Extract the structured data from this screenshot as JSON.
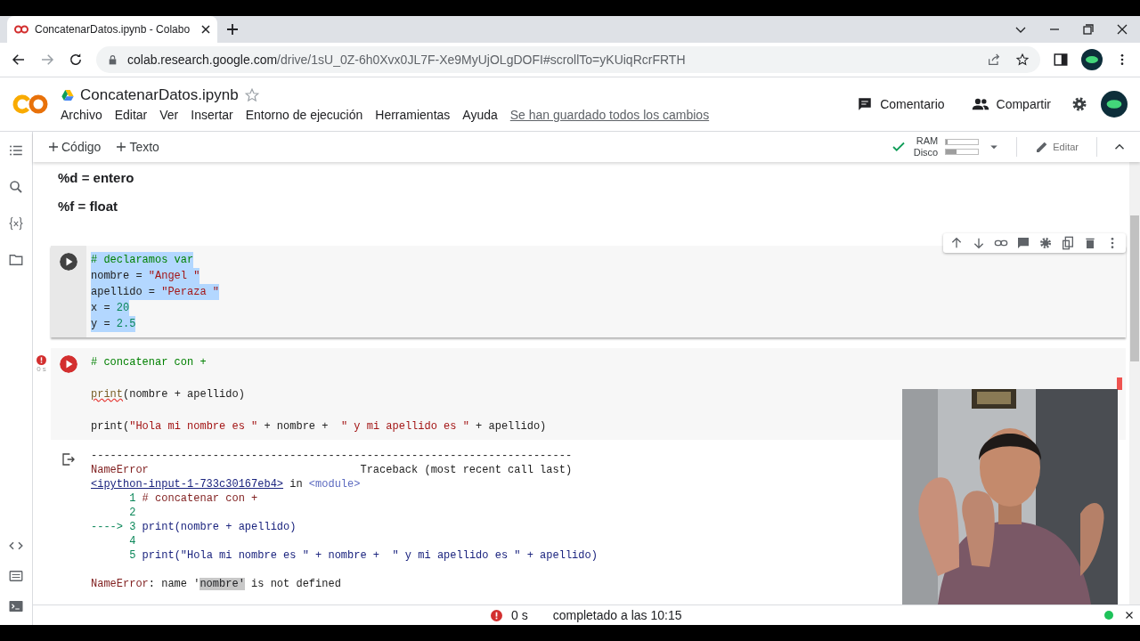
{
  "browser": {
    "tab_title": "ConcatenarDatos.ipynb - Colabo",
    "url_host": "colab.research.google.com",
    "url_path": "/drive/1sU_0Z-6h0Xvx0JL7F-Xe9MyUjOLgDOFI#scrollTo=yKUiqRcrFRTH"
  },
  "header": {
    "title": "ConcatenarDatos.ipynb",
    "menu": [
      "Archivo",
      "Editar",
      "Ver",
      "Insertar",
      "Entorno de ejecución",
      "Herramientas",
      "Ayuda"
    ],
    "save_status": "Se han guardado todos los cambios",
    "comment": "Comentario",
    "share": "Compartir"
  },
  "toolbar": {
    "add_code": "Código",
    "add_text": "Texto",
    "ram_label": "RAM",
    "disk_label": "Disco",
    "ram": {
      "level": 0.04
    },
    "disk": {
      "level": 0.32
    },
    "edit": "Editar"
  },
  "text_cells": [
    "%d = entero",
    "%f = float"
  ],
  "cells": [
    {
      "selected": true,
      "error": false,
      "lines": [
        {
          "blank_before": false,
          "tokens": [
            {
              "text": "# declaramos var",
              "kind": "comment"
            }
          ]
        },
        {
          "blank_before": false,
          "tokens": [
            {
              "text": "nombre = ",
              "kind": "plain"
            },
            {
              "text": "\"Angel \"",
              "kind": "string"
            }
          ]
        },
        {
          "blank_before": false,
          "tokens": [
            {
              "text": "apellido = ",
              "kind": "plain"
            },
            {
              "text": "\"Peraza \"",
              "kind": "string"
            }
          ]
        },
        {
          "blank_before": false,
          "tokens": [
            {
              "text": "x = ",
              "kind": "plain"
            },
            {
              "text": "20",
              "kind": "number"
            }
          ]
        },
        {
          "blank_before": false,
          "tokens": [
            {
              "text": "y = ",
              "kind": "plain"
            },
            {
              "text": "2.5",
              "kind": "number"
            }
          ]
        }
      ]
    },
    {
      "selected": false,
      "error": true,
      "exec_time": "0 s",
      "lines": [
        {
          "blank_before": false,
          "tokens": [
            {
              "text": "# concatenar con +",
              "kind": "comment"
            }
          ]
        },
        {
          "blank_before": true,
          "tokens": [
            {
              "text": "print",
              "kind": "squiggle"
            },
            {
              "text": "(nombre + apellido)",
              "kind": "plain"
            }
          ]
        },
        {
          "blank_before": true,
          "tokens": [
            {
              "text": "print(",
              "kind": "plain"
            },
            {
              "text": "\"Hola mi nombre es \"",
              "kind": "string"
            },
            {
              "text": " + nombre +  ",
              "kind": "plain"
            },
            {
              "text": "\" y mi apellido es \"",
              "kind": "string"
            },
            {
              "text": " + apellido)",
              "kind": "plain"
            }
          ]
        }
      ],
      "output": [
        {
          "blank_before": false,
          "tokens": [
            {
              "text": "---------------------------------------------------------------------------",
              "kind": "plain"
            }
          ]
        },
        {
          "blank_before": false,
          "tokens": [
            {
              "text": "NameError",
              "kind": "error"
            },
            {
              "text": "                                 Traceback (most recent call last)",
              "kind": "plain"
            }
          ]
        },
        {
          "blank_before": false,
          "tokens": [
            {
              "text": "<ipython-input-1-733c30167eb4>",
              "kind": "link"
            },
            {
              "text": " in ",
              "kind": "plain"
            },
            {
              "text": "<module>",
              "kind": "module"
            }
          ]
        },
        {
          "blank_before": false,
          "tokens": [
            {
              "text": "      1",
              "kind": "number"
            },
            {
              "text": " # concatenar con +",
              "kind": "error"
            }
          ]
        },
        {
          "blank_before": false,
          "tokens": [
            {
              "text": "      2",
              "kind": "number"
            }
          ]
        },
        {
          "blank_before": false,
          "tokens": [
            {
              "text": "----> 3",
              "kind": "number"
            },
            {
              "text": " print(nombre + apellido)",
              "kind": "code"
            }
          ]
        },
        {
          "blank_before": false,
          "tokens": [
            {
              "text": "      4",
              "kind": "number"
            }
          ]
        },
        {
          "blank_before": false,
          "tokens": [
            {
              "text": "      5",
              "kind": "number"
            },
            {
              "text": " print(\"Hola mi nombre es \" + nombre +  \" y mi apellido es \" + apellido)",
              "kind": "code"
            }
          ]
        },
        {
          "blank_before": true,
          "tokens": [
            {
              "text": "NameError",
              "kind": "error"
            },
            {
              "text": ": name '",
              "kind": "plain"
            },
            {
              "text": "nombre'",
              "kind": "highlight"
            },
            {
              "text": " is not defined",
              "kind": "plain"
            }
          ]
        }
      ]
    }
  ],
  "webcam": {
    "kind": "picture"
  },
  "status_bar": {
    "time": "0 s",
    "message": "completado a las 10:15"
  }
}
